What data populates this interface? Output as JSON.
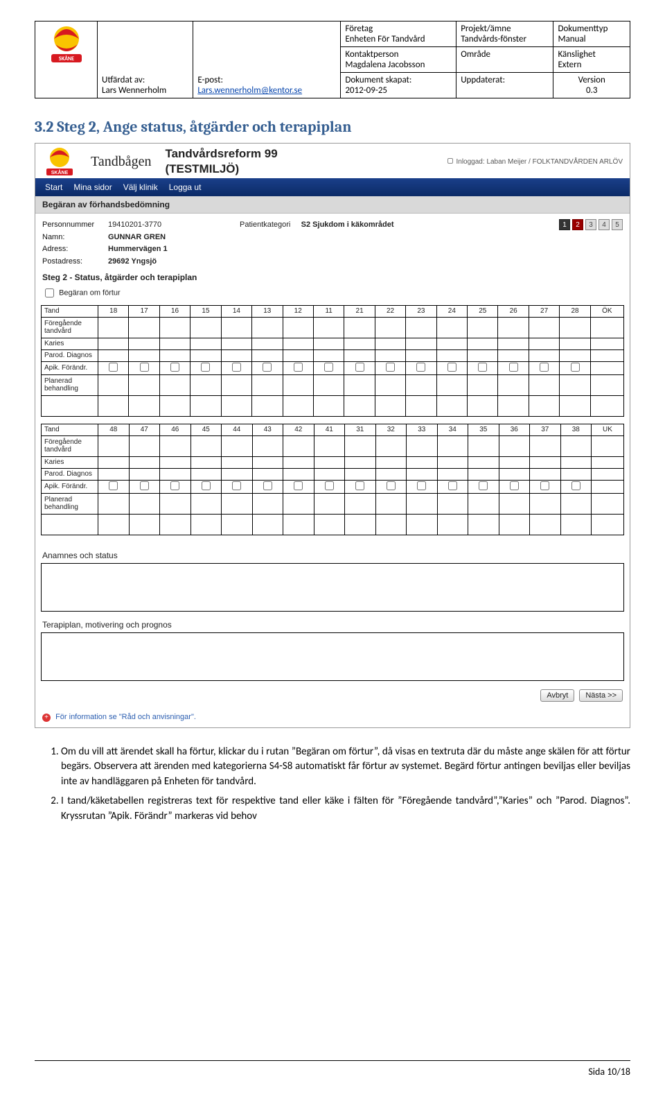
{
  "header": {
    "logo_label": "REGION SKÅNE",
    "col1": {
      "utfardat_lbl": "Utfärdat av:",
      "utfardat_val": "Lars Wennerholm",
      "epost_lbl": "E-post:",
      "epost_val": "Lars.wennerholm@kentor.se"
    },
    "col2": {
      "foretag_lbl": "Företag",
      "foretag_val": "Enheten För Tandvård",
      "kontakt_lbl": "Kontaktperson",
      "kontakt_val": "Magdalena Jacobsson",
      "dokskap_lbl": "Dokument skapat:",
      "dokskap_val": "2012-09-25"
    },
    "col3": {
      "projekt_lbl": "Projekt/ämne",
      "projekt_val": "Tandvårds-fönster",
      "omrade_lbl": "Område",
      "omrade_val": "",
      "uppdat_lbl": "Uppdaterat:",
      "uppdat_val": ""
    },
    "col4": {
      "doktyp_lbl": "Dokumenttyp",
      "doktyp_val": "Manual",
      "kansl_lbl": "Känslighet",
      "kansl_val": "Extern",
      "version_lbl": "Version",
      "version_val": "0.3"
    }
  },
  "section_heading": "3.2  Steg 2, Ange status, åtgärder och terapiplan",
  "shot": {
    "brand": "SKÅNE",
    "app": "Tandbågen",
    "subtitle1": "Tandvårdsreform 99",
    "subtitle2": "(TESTMILJÖ)",
    "login_prefix": "Inloggad:",
    "login_user": "Laban Meijer / FOLKTANDVÅRDEN ARLÖV",
    "nav": {
      "start": "Start",
      "mina": "Mina sidor",
      "valj": "Välj klinik",
      "logga": "Logga ut"
    },
    "graybar": "Begäran av förhandsbedömning",
    "patient": {
      "pn_lbl": "Personnummer",
      "pn_val": "19410201-3770",
      "namn_lbl": "Namn:",
      "namn_val": "GUNNAR GREN",
      "adr_lbl": "Adress:",
      "adr_val": "Hummervägen 1",
      "post_lbl": "Postadress:",
      "post_val": "29692 Yngsjö",
      "patkat_lbl": "Patientkategori",
      "patkat_val": "S2 Sjukdom i käkområdet"
    },
    "steps": [
      "1",
      "2",
      "3",
      "4",
      "5"
    ],
    "stepname": "Steg 2 - Status, åtgärder och terapiplan",
    "fortur_chk": "Begäran om förtur",
    "teeth_rows": [
      "Tand",
      "Föregående tandvård",
      "Karies",
      "Parod. Diagnos",
      "Apik. Förändr.",
      "Planerad behandling"
    ],
    "upper": [
      "18",
      "17",
      "16",
      "15",
      "14",
      "13",
      "12",
      "11",
      "21",
      "22",
      "23",
      "24",
      "25",
      "26",
      "27",
      "28",
      "ÖK"
    ],
    "lower": [
      "48",
      "47",
      "46",
      "45",
      "44",
      "43",
      "42",
      "41",
      "31",
      "32",
      "33",
      "34",
      "35",
      "36",
      "37",
      "38",
      "UK"
    ],
    "anamnes_lbl": "Anamnes och status",
    "terapi_lbl": "Terapiplan, motivering och prognos",
    "btn_cancel": "Avbryt",
    "btn_next": "Nästa >>",
    "infolink": "För information se \"Råd och anvisningar\"."
  },
  "body": {
    "li1": "Om du vill att ärendet skall ha förtur, klickar du i rutan ”Begäran om förtur”, då visas en textruta där du måste ange skälen för att förtur begärs. Observera att ärenden med kategorierna  S4-S8 automatiskt får förtur av systemet. Begärd förtur antingen beviljas eller beviljas inte av handläggaren på Enheten för tandvård.",
    "li2": "I tand/käketabellen registreras text för respektive tand eller käke i fälten för ”Föregående tandvård”,”Karies” och ”Parod. Diagnos”. Kryssrutan ”Apik. Förändr” markeras vid behov"
  },
  "footer": "Sida 10/18"
}
